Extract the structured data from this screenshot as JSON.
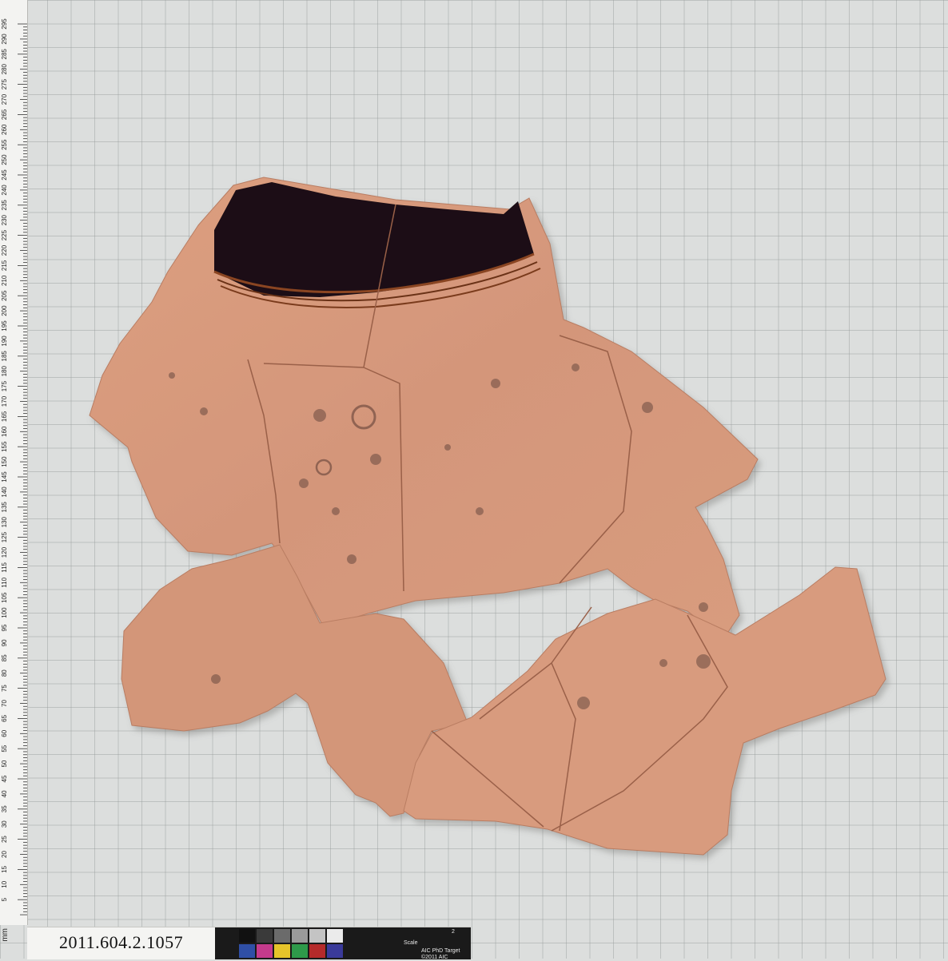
{
  "ruler": {
    "unit": "mm",
    "labels": [
      "295",
      "290",
      "285",
      "280",
      "275",
      "270",
      "265",
      "260",
      "255",
      "250",
      "245",
      "240",
      "235",
      "230",
      "225",
      "220",
      "215",
      "210",
      "205",
      "200",
      "195",
      "190",
      "185",
      "180",
      "175",
      "170",
      "165",
      "160",
      "155",
      "150",
      "145",
      "140",
      "135",
      "130",
      "125",
      "120",
      "115",
      "110",
      "105",
      "100",
      "95",
      "90",
      "85",
      "80",
      "75",
      "70",
      "65",
      "60",
      "55",
      "50",
      "45",
      "40",
      "35",
      "30",
      "25",
      "20",
      "15",
      "10",
      "5"
    ]
  },
  "label": {
    "accession": "2011.604.2.1057"
  },
  "target": {
    "line1": "AIC PhD Target",
    "line2": "©2011 AIC",
    "scale_label": "Scale",
    "scale_tick": "2",
    "patch_colors_top": [
      "#111111",
      "#3a3a3a",
      "#6b6b6b",
      "#9a9a9a",
      "#c4c4c4",
      "#ebebeb"
    ],
    "patch_colors_bottom": [
      "#2f4fa6",
      "#c43a8c",
      "#e6c42a",
      "#2e9a4a",
      "#b52a2a",
      "#3a3a9a"
    ]
  },
  "artifact": {
    "clay_color": "#d89a7a",
    "black_glaze_color": "#1c1012"
  }
}
